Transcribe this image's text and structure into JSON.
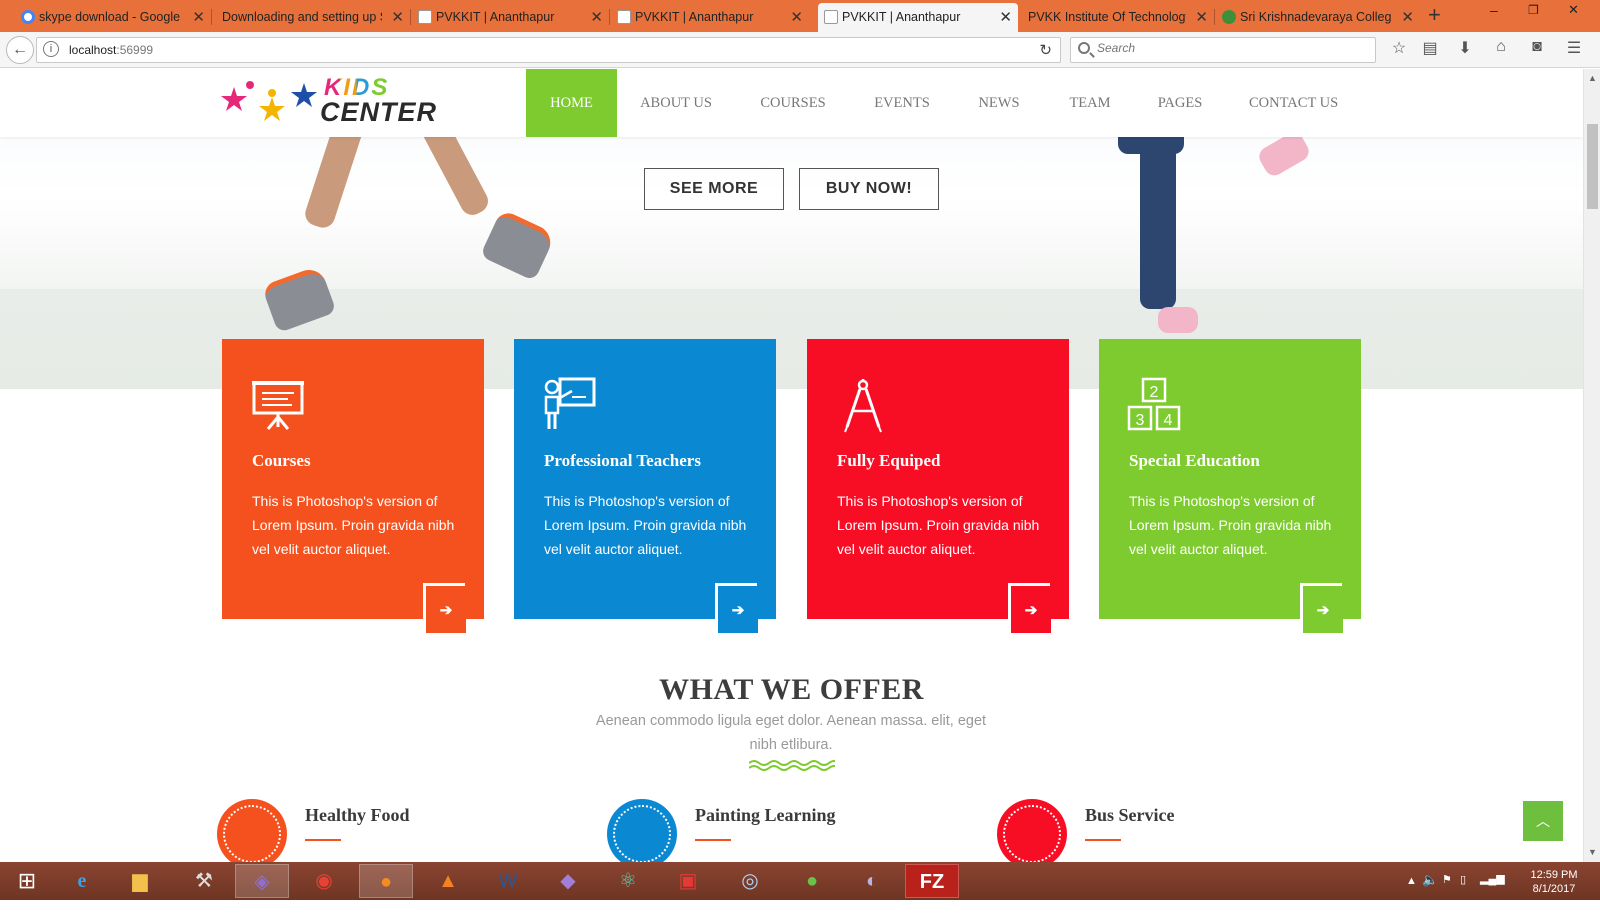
{
  "browser": {
    "tabs": [
      {
        "title": "skype download - Google",
        "icon": "google-icon",
        "active": false
      },
      {
        "title": "Downloading and setting up Sk",
        "icon": "",
        "active": false
      },
      {
        "title": "PVKKIT | Ananthapur",
        "icon": "page-icon",
        "active": false
      },
      {
        "title": "PVKKIT | Ananthapur",
        "icon": "page-icon",
        "active": false
      },
      {
        "title": "PVKKIT | Ananthapur",
        "icon": "page-icon",
        "active": true
      },
      {
        "title": "PVKK Institute Of Technology",
        "icon": "",
        "active": false
      },
      {
        "title": "Sri Krishnadevaraya Colleg",
        "icon": "emblem-icon",
        "active": false
      }
    ],
    "new_tab": "+",
    "url_host": "localhost",
    "url_port": ":56999",
    "search_placeholder": "Search"
  },
  "site": {
    "logo_kids": "KIDS",
    "logo_center": "CENTER",
    "menu": [
      "HOME",
      "ABOUT US",
      "COURSES",
      "EVENTS",
      "NEWS",
      "TEAM",
      "PAGES",
      "CONTACT US"
    ],
    "active_menu": "HOME",
    "hero_buttons": {
      "see_more": "SEE MORE",
      "buy_now": "BUY NOW!"
    }
  },
  "features": [
    {
      "title": "Courses",
      "text": "This is Photoshop's version of Lorem Ipsum. Proin gravida nibh vel velit auctor aliquet.",
      "color": "#f4511e",
      "icon": "presentation-board-icon"
    },
    {
      "title": "Professional Teachers",
      "text": "This is Photoshop's version of Lorem Ipsum. Proin gravida nibh vel velit auctor aliquet.",
      "color": "#0a88d1",
      "icon": "teacher-icon"
    },
    {
      "title": "Fully Equiped",
      "text": "This is Photoshop's version of Lorem Ipsum. Proin gravida nibh vel velit auctor aliquet.",
      "color": "#f70d24",
      "icon": "compass-icon"
    },
    {
      "title": "Special Education",
      "text": "This is Photoshop's version of Lorem Ipsum. Proin gravida nibh vel velit auctor aliquet.",
      "color": "#7ecb2f",
      "icon": "number-blocks-icon"
    }
  ],
  "offer_section": {
    "title": "WHAT WE OFFER",
    "subtitle": "Aenean commodo ligula eget dolor. Aenean massa. elit, eget nibh etlibura.",
    "items": [
      {
        "title": "Healthy Food",
        "color": "#f4511e",
        "icon": "food-icon"
      },
      {
        "title": "Painting Learning",
        "color": "#0a88d1",
        "icon": "paint-icon"
      },
      {
        "title": "Bus Service",
        "color": "#f70d24",
        "icon": "bus-icon"
      }
    ]
  },
  "taskbar": {
    "time": "12:59 PM",
    "date": "8/1/2017"
  }
}
